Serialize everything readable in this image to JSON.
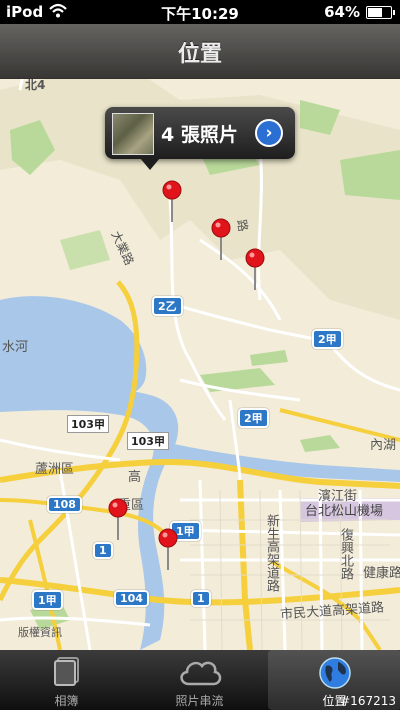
{
  "status": {
    "carrier": "iPod",
    "time": "下午10:29",
    "battery": "64%",
    "battery_level": 0.64
  },
  "navbar": {
    "title": "位置"
  },
  "callout": {
    "text": "4 張照片",
    "disclosure": "›"
  },
  "map_labels": {
    "bei4": "北4",
    "daye_road": "大業路",
    "shuihe": "水河",
    "luzhou": "蘆洲區",
    "sanchong": "重區",
    "gao": "高",
    "neihu": "內湖",
    "binjiang": "濱江街",
    "airport": "台北松山機場",
    "xinsheng": "新生高架道路",
    "fuxing": "復興北路",
    "jiankang": "健康路",
    "civic": "市民大道高架道路",
    "banquan": "版權資訊",
    "rd_right": "路"
  },
  "shields": {
    "s2yi": "2乙",
    "s2jia_a": "2甲",
    "s2jia_b": "2甲",
    "s108": "108",
    "s1_a": "1",
    "s1_b": "1",
    "s1_c": "1",
    "s104": "104",
    "s1jia_a": "1甲",
    "s1jia_b": "1甲"
  },
  "tags": {
    "t103a": "103甲",
    "t103b": "103甲"
  },
  "tabs": [
    {
      "label": "相簿",
      "icon": "album-icon"
    },
    {
      "label": "照片串流",
      "icon": "cloud-icon"
    },
    {
      "label": "位置",
      "icon": "globe-icon"
    }
  ],
  "watermark": "#167213",
  "colors": {
    "map_bg": "#f2ecd9",
    "water": "#a9c7e8",
    "park": "#b9d99a",
    "road_yellow": "#f6cf3c",
    "pin_red": "#e0141a"
  }
}
